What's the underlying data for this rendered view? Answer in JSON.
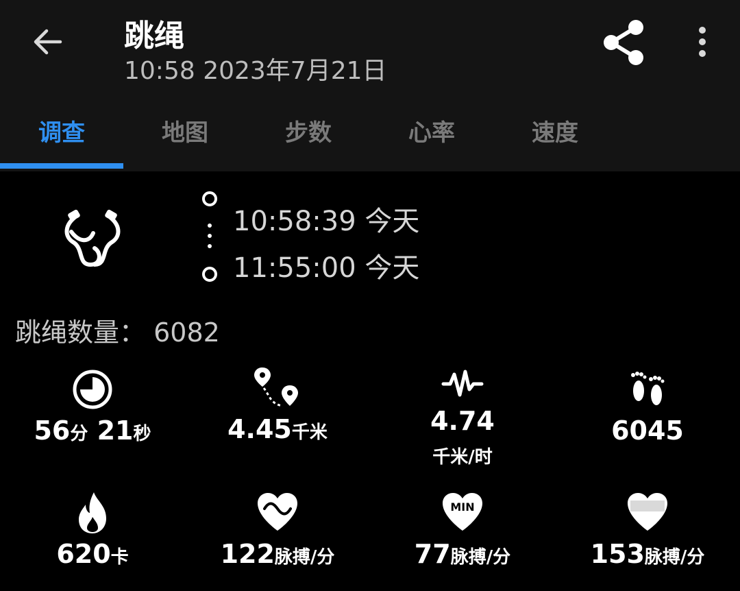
{
  "header": {
    "title": "跳绳",
    "datetime": "10:58 2023年7月21日"
  },
  "tabs": [
    {
      "label": "调查",
      "active": true
    },
    {
      "label": "地图",
      "active": false
    },
    {
      "label": "步数",
      "active": false
    },
    {
      "label": "心率",
      "active": false
    },
    {
      "label": "速度",
      "active": false
    }
  ],
  "activity": {
    "icon": "jump-rope-icon",
    "start_time": "10:58:39",
    "start_day": "今天",
    "end_time": "11:55:00",
    "end_day": "今天"
  },
  "count": {
    "label": "跳绳数量：",
    "value": "6082"
  },
  "stats": {
    "duration": {
      "icon": "timer-icon",
      "min_value": "56",
      "min_unit": "分",
      "sec_value": "21",
      "sec_unit": "秒"
    },
    "distance": {
      "icon": "route-icon",
      "value": "4.45",
      "unit": "千米"
    },
    "speed": {
      "icon": "pulse-wave-icon",
      "value": "4.74",
      "unit": "千米/时"
    },
    "steps": {
      "icon": "footprints-icon",
      "value": "6045"
    },
    "calories": {
      "icon": "flame-icon",
      "value": "620",
      "unit": "卡"
    },
    "avg_hr": {
      "icon": "heart-wave-icon",
      "value": "122",
      "unit": "脉搏/分"
    },
    "min_hr": {
      "icon": "heart-min-icon",
      "icon_text": "MIN",
      "value": "77",
      "unit": "脉搏/分"
    },
    "max_hr": {
      "icon": "heart-max-icon",
      "value": "153",
      "unit": "脉搏/分"
    }
  },
  "colors": {
    "accent": "#2f8ff0",
    "header_bg": "#141414",
    "background": "#000000"
  }
}
